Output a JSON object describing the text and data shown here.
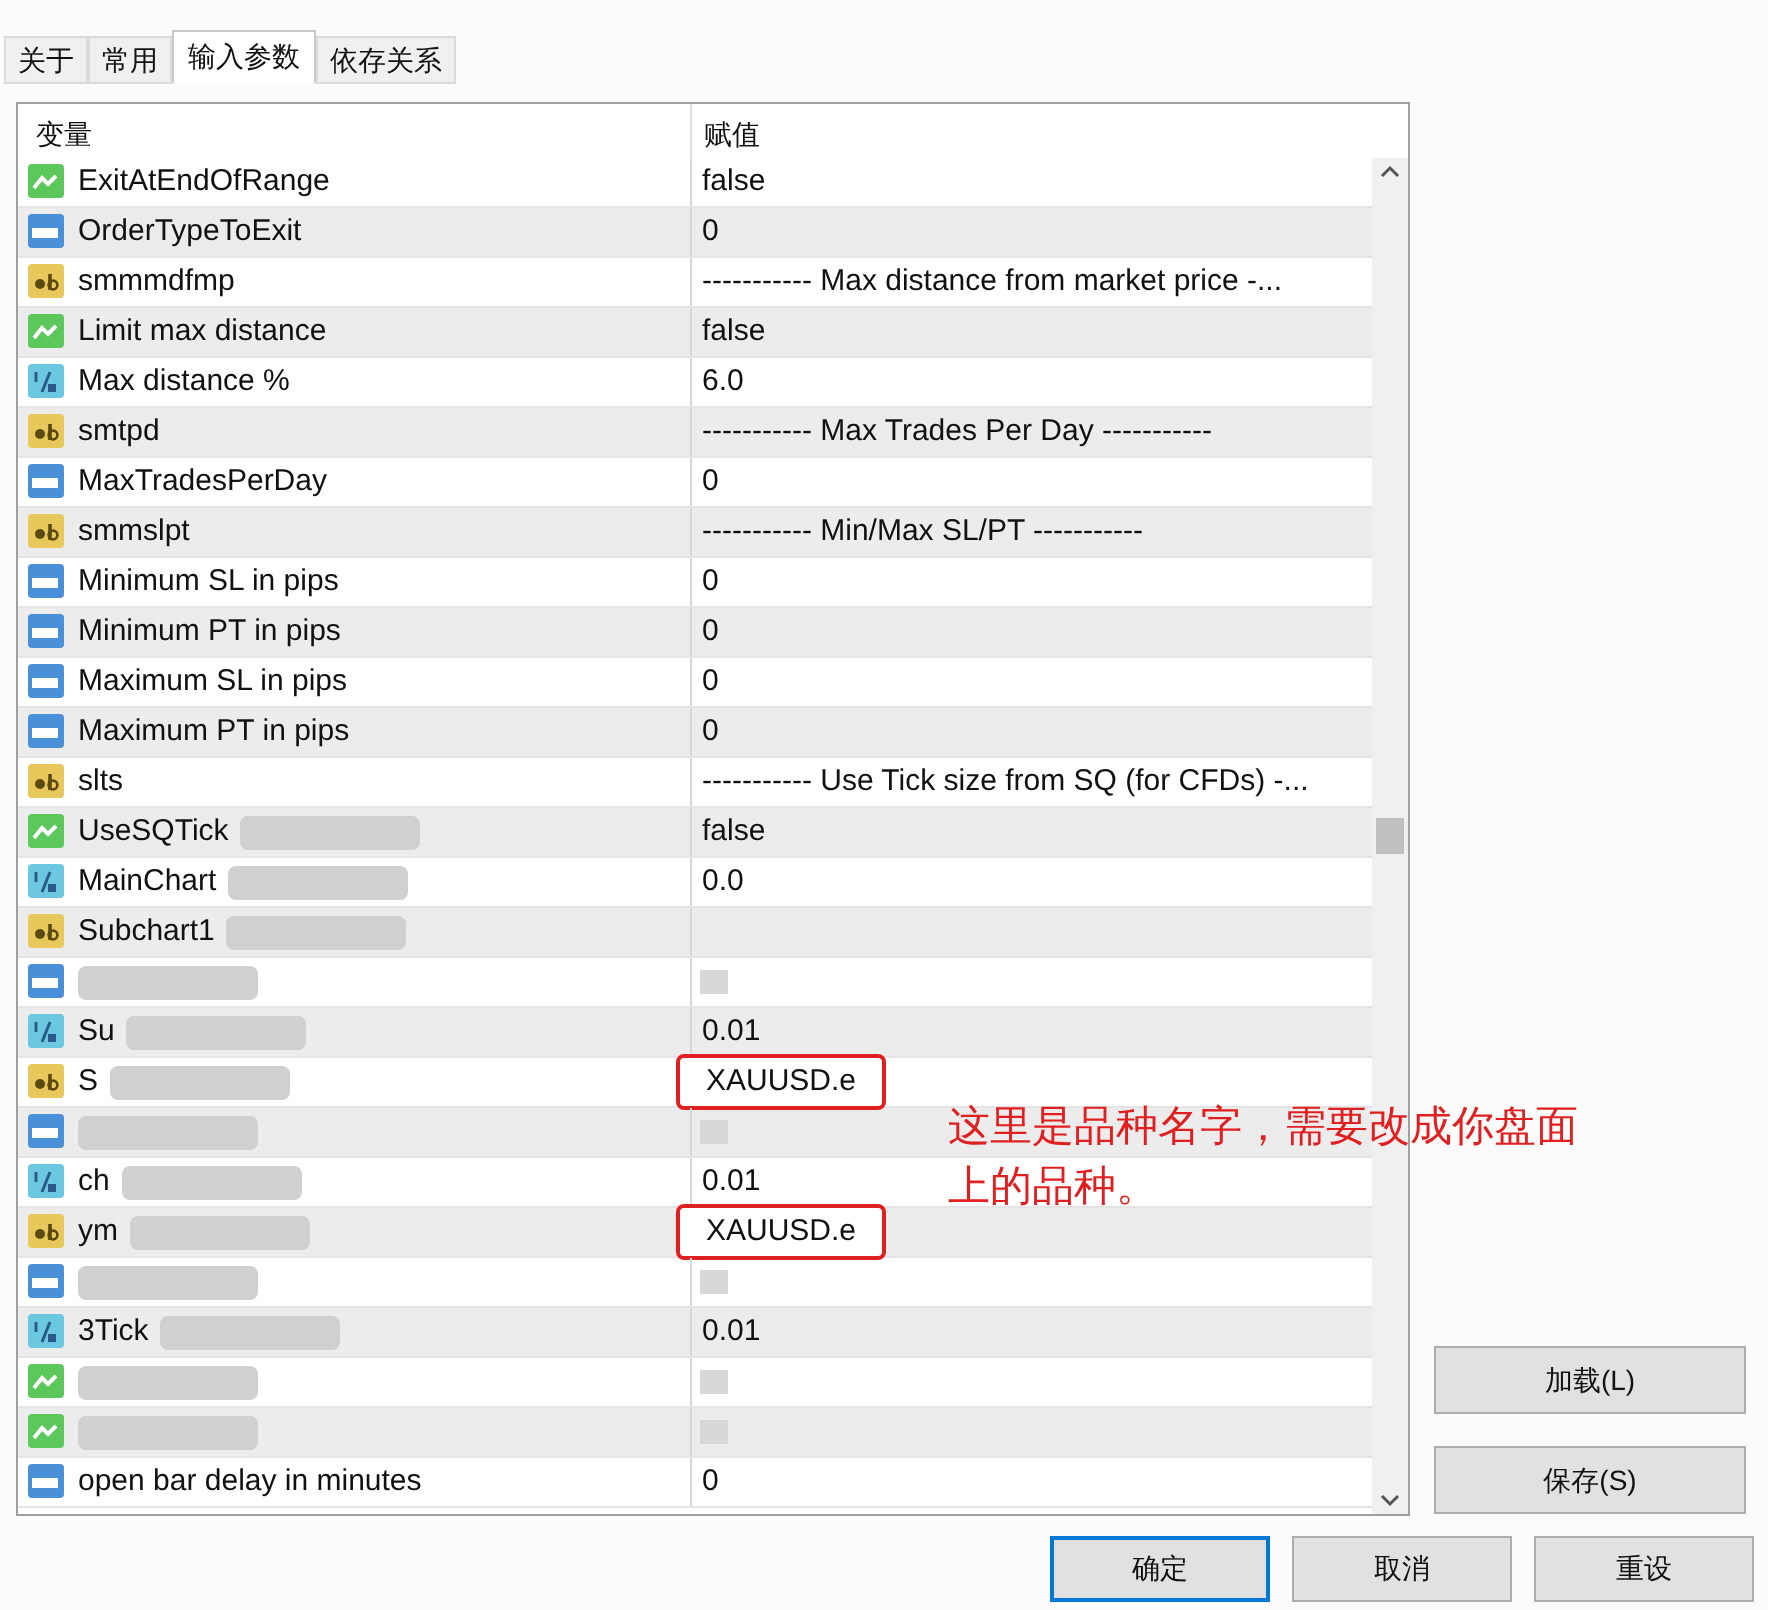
{
  "tabs": [
    {
      "label": "关于",
      "selected": false
    },
    {
      "label": "常用",
      "selected": false
    },
    {
      "label": "输入参数",
      "selected": true
    },
    {
      "label": "依存关系",
      "selected": false
    }
  ],
  "table": {
    "columns": [
      "变量",
      "赋值"
    ],
    "rows": [
      {
        "kind": "bool",
        "name": "ExitAtEndOfRange",
        "value": "false",
        "blurred": false,
        "marked": false
      },
      {
        "kind": "int",
        "name": "OrderTypeToExit",
        "value": "0",
        "blurred": false,
        "marked": false
      },
      {
        "kind": "string",
        "name": "smmmdfmp",
        "value": "----------- Max distance from market price -...",
        "blurred": false,
        "marked": false
      },
      {
        "kind": "bool",
        "name": "Limit max distance",
        "value": "false",
        "blurred": false,
        "marked": false
      },
      {
        "kind": "double",
        "name": "Max distance %",
        "value": "6.0",
        "blurred": false,
        "marked": false
      },
      {
        "kind": "string",
        "name": "smtpd",
        "value": "----------- Max Trades Per Day -----------",
        "blurred": false,
        "marked": false
      },
      {
        "kind": "int",
        "name": "MaxTradesPerDay",
        "value": "0",
        "blurred": false,
        "marked": false
      },
      {
        "kind": "string",
        "name": "smmslpt",
        "value": "----------- Min/Max SL/PT -----------",
        "blurred": false,
        "marked": false
      },
      {
        "kind": "int",
        "name": "Minimum SL in pips",
        "value": "0",
        "blurred": false,
        "marked": false
      },
      {
        "kind": "int",
        "name": "Minimum PT in pips",
        "value": "0",
        "blurred": false,
        "marked": false
      },
      {
        "kind": "int",
        "name": "Maximum SL in pips",
        "value": "0",
        "blurred": false,
        "marked": false
      },
      {
        "kind": "int",
        "name": "Maximum PT in pips",
        "value": "0",
        "blurred": false,
        "marked": false
      },
      {
        "kind": "string",
        "name": "slts",
        "value": "----------- Use Tick size from SQ (for CFDs) -...",
        "blurred": false,
        "marked": false
      },
      {
        "kind": "bool",
        "name": "UseSQTick",
        "value": "false",
        "blurred": true,
        "marked": false
      },
      {
        "kind": "double",
        "name": "MainChart",
        "value": "0.0",
        "blurred": true,
        "marked": false
      },
      {
        "kind": "string",
        "name": "Subchart1",
        "blurred": true,
        "marked": false
      },
      {
        "kind": "int",
        "blurred": true,
        "marked": false
      },
      {
        "kind": "double",
        "name": "Su",
        "value": "0.01",
        "blurred": true,
        "marked": false
      },
      {
        "kind": "string",
        "name": "S",
        "value": "XAUUSD.e",
        "blurred": true,
        "marked": true
      },
      {
        "kind": "int",
        "blurred": true,
        "marked": false
      },
      {
        "kind": "double",
        "name": "ch",
        "value": "0.01",
        "blurred": true,
        "marked": false
      },
      {
        "kind": "string",
        "name": "ym",
        "value": "XAUUSD.e",
        "blurred": true,
        "marked": true
      },
      {
        "kind": "int",
        "blurred": true,
        "marked": false
      },
      {
        "kind": "double",
        "name": "3Tick",
        "value": "0.01",
        "blurred": true,
        "marked": false
      },
      {
        "kind": "bool",
        "blurred": true,
        "marked": false
      },
      {
        "kind": "bool",
        "blurred": true,
        "marked": false
      },
      {
        "kind": "int",
        "name": "open bar delay in minutes",
        "value": "0",
        "blurred": false,
        "marked": false
      }
    ]
  },
  "annotation": [
    "这里是品种名字，需要改成你盘面",
    "上的品种。"
  ],
  "side_buttons": [
    "加载(L)",
    "保存(S)"
  ],
  "buttons": [
    {
      "label": "确定",
      "default": true
    },
    {
      "label": "取消",
      "default": false
    },
    {
      "label": "重设",
      "default": false
    }
  ]
}
